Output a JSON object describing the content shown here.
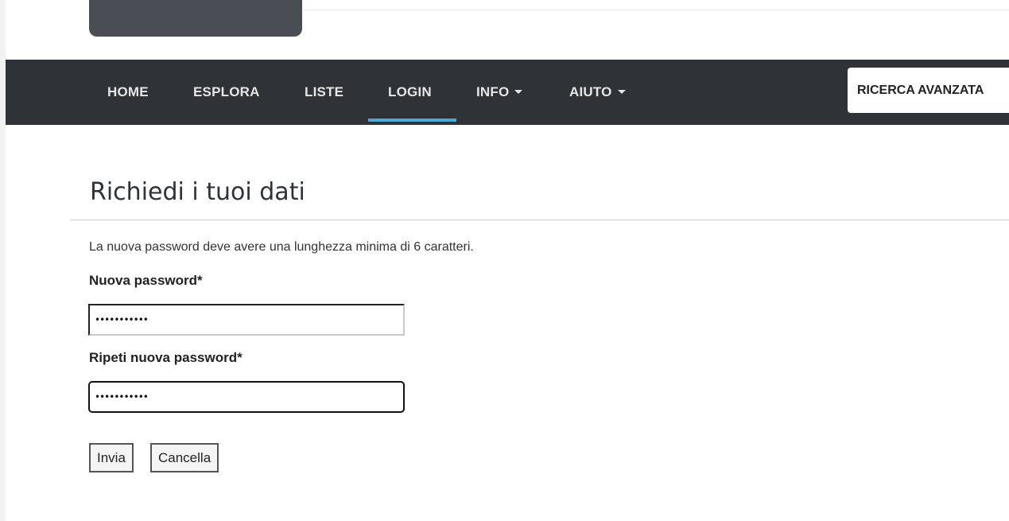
{
  "nav": {
    "items": [
      {
        "label": "HOME",
        "dropdown": false
      },
      {
        "label": "ESPLORA",
        "dropdown": false
      },
      {
        "label": "LISTE",
        "dropdown": false
      },
      {
        "label": "LOGIN",
        "dropdown": false,
        "active": true
      },
      {
        "label": "INFO",
        "dropdown": true
      },
      {
        "label": "AIUTO",
        "dropdown": true
      }
    ],
    "advanced_search_label": "RICERCA AVANZATA",
    "active_color": "#4aa8d4",
    "bar_color": "#2f3236"
  },
  "main": {
    "title": "Richiedi i tuoi dati",
    "intro": "La nuova password deve avere una lunghezza minima di 6 caratteri.",
    "fields": {
      "new_password": {
        "label": "Nuova password*",
        "value": "•••••••••••"
      },
      "repeat_password": {
        "label": "Ripeti nuova password*",
        "value": "•••••••••••"
      }
    },
    "buttons": {
      "submit": "Invia",
      "cancel": "Cancella"
    }
  }
}
